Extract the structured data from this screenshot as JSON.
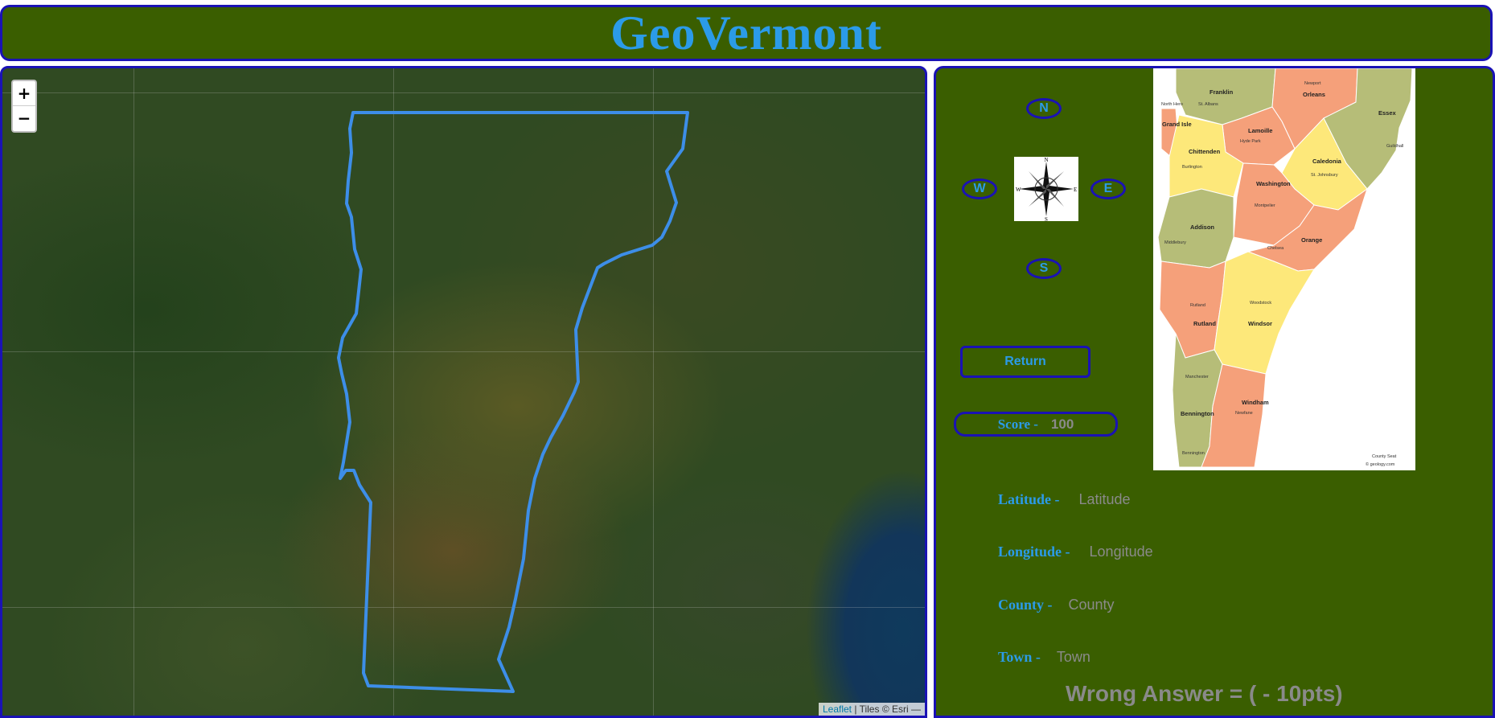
{
  "header": {
    "title": "GeoVermont"
  },
  "map": {
    "zoom_in": "+",
    "zoom_out": "−",
    "attribution": {
      "leaflet": "Leaflet",
      "tiles": "| Tiles © Esri —"
    }
  },
  "compass": {
    "north": "N",
    "west": "W",
    "east": "E",
    "south": "S",
    "rose_letters": {
      "n": "N",
      "s": "S",
      "w": "W",
      "e": "E"
    }
  },
  "return_label": "Return",
  "score": {
    "label": "Score -",
    "value": "100"
  },
  "fields": {
    "latitude": {
      "label": "Latitude -",
      "value": "Latitude"
    },
    "longitude": {
      "label": "Longitude -",
      "value": "Longitude"
    },
    "county": {
      "label": "County -",
      "value": "County"
    },
    "town": {
      "label": "Town -",
      "value": "Town"
    }
  },
  "penalty_text": "Wrong Answer = ( - 10pts)",
  "vermont_map": {
    "counties": [
      "Franklin",
      "Orleans",
      "Essex",
      "Grand Isle",
      "Lamoille",
      "Chittenden",
      "Caledonia",
      "Washington",
      "Addison",
      "Orange",
      "Rutland",
      "Windsor",
      "Bennington",
      "Windham"
    ],
    "towns": [
      "North Hero",
      "St. Albans",
      "Newport",
      "Hyde Park",
      "Guildhall",
      "Burlington",
      "St. Johnsbury",
      "Montpelier",
      "Middlebury",
      "Chelsea",
      "Rutland",
      "Woodstock",
      "Manchester",
      "Newfane",
      "Bennington"
    ],
    "legend": "County Seat",
    "credit": "© geology.com"
  },
  "colors": {
    "panel_bg": "#3a5e00",
    "border": "#1a12b5",
    "accent_text": "#2b9be8",
    "muted_text": "#8a8a8a",
    "state_outline": "#3d8ee8"
  }
}
